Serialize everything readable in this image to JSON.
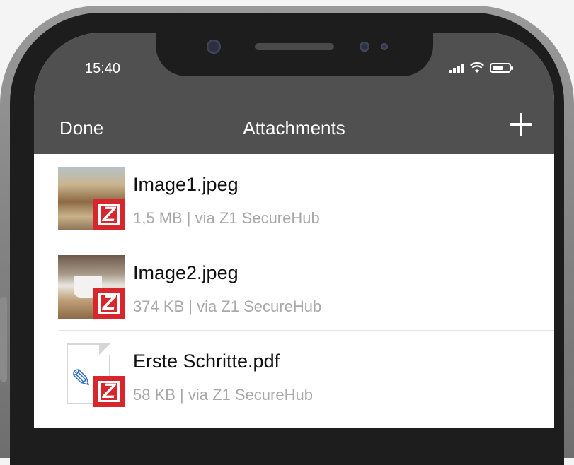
{
  "status_bar": {
    "time": "15:40"
  },
  "nav": {
    "done_label": "Done",
    "title": "Attachments",
    "add_icon": "plus-icon"
  },
  "files": [
    {
      "name": "Image1.jpeg",
      "meta": "1,5 MB | via Z1 SecureHub",
      "badge": "Z"
    },
    {
      "name": "Image2.jpeg",
      "meta": "374 KB | via Z1 SecureHub",
      "badge": "Z"
    },
    {
      "name": "Erste Schritte.pdf",
      "meta": "58 KB | via Z1 SecureHub",
      "badge": "Z"
    }
  ],
  "colors": {
    "nav_bar": "#505050",
    "badge_red": "#d7262c",
    "meta_gray": "#a8a8a8"
  }
}
